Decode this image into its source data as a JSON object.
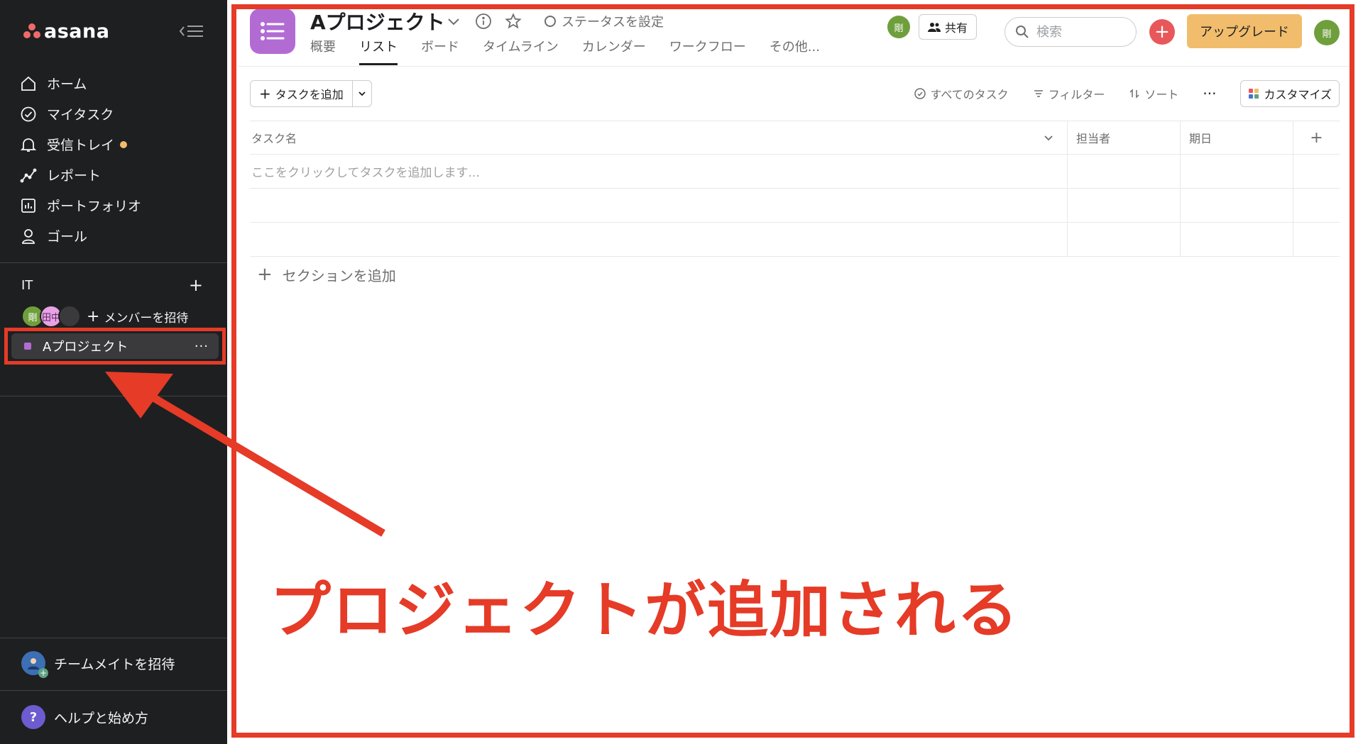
{
  "sidebar": {
    "logo_text": "asana",
    "nav": [
      {
        "label": "ホーム",
        "icon": "home-icon"
      },
      {
        "label": "マイタスク",
        "icon": "check-circle-icon"
      },
      {
        "label": "受信トレイ",
        "icon": "bell-icon"
      },
      {
        "label": "レポート",
        "icon": "report-icon"
      },
      {
        "label": "ポートフォリオ",
        "icon": "portfolio-icon"
      },
      {
        "label": "ゴール",
        "icon": "goal-icon"
      }
    ],
    "team": {
      "name": "IT",
      "members": [
        "剛",
        "田中",
        ""
      ],
      "invite_label": "メンバーを招待"
    },
    "project": {
      "name": "Aプロジェクト",
      "color": "#b36bd4",
      "more": "···"
    },
    "invite_teammate": "チームメイトを招待",
    "help": "ヘルプと始め方",
    "help_glyph": "?"
  },
  "header": {
    "project_title": "Aプロジェクト",
    "status_label": "ステータスを設定",
    "tabs": [
      "概要",
      "リスト",
      "ボード",
      "タイムライン",
      "カレンダー",
      "ワークフロー",
      "その他..."
    ],
    "active_tab": "リスト",
    "member_avatar": "剛",
    "share_label": "共有",
    "search_placeholder": "検索",
    "upgrade_label": "アップグレード",
    "user_avatar": "剛"
  },
  "toolbar": {
    "add_task_label": "タスクを追加",
    "all_tasks_label": "すべてのタスク",
    "filter_label": "フィルター",
    "sort_label": "ソート",
    "more_label": "···",
    "customize_label": "カスタマイズ"
  },
  "table": {
    "columns": [
      "タスク名",
      "担当者",
      "期日"
    ],
    "add_column_glyph": "+",
    "placeholder_row": "ここをクリックしてタスクを追加します..."
  },
  "add_section_label": "セクションを追加",
  "annotation_text": "プロジェクトが追加される",
  "colors": {
    "sidebar_bg": "#1e1f21",
    "accent_red": "#e53b27",
    "project_purple": "#b36bd4",
    "upgrade_yellow": "#f1bd6c",
    "add_button_red": "#e8585b"
  }
}
